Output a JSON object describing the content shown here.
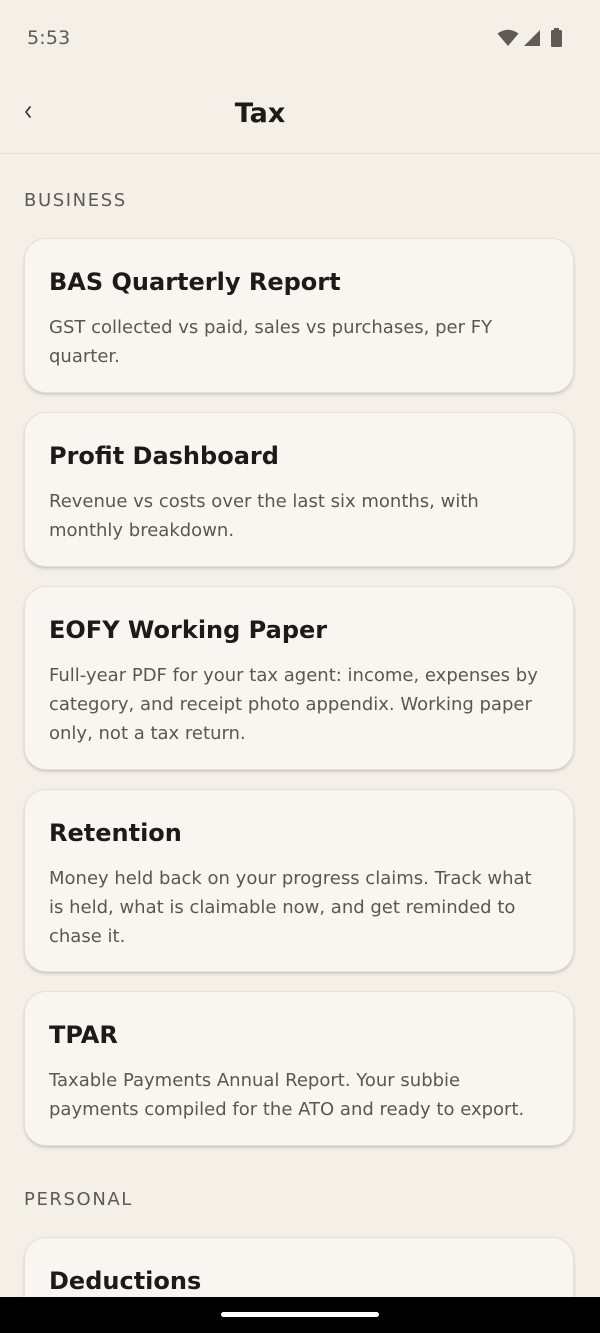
{
  "status_bar": {
    "time": "5:53",
    "icons": [
      "wifi-icon",
      "cellular-signal-icon",
      "battery-icon"
    ]
  },
  "app_bar": {
    "back_icon": "chevron-left-icon",
    "title": "Tax"
  },
  "sections": [
    {
      "label": "BUSINESS",
      "cards": [
        {
          "title": "BAS Quarterly Report",
          "description": "GST collected vs paid, sales vs purchases, per FY quarter."
        },
        {
          "title": "Profit Dashboard",
          "description": "Revenue vs costs over the last six months, with monthly breakdown."
        },
        {
          "title": "EOFY Working Paper",
          "description": "Full-year PDF for your tax agent: income, expenses by category, and receipt photo appendix. Working paper only, not a tax return."
        },
        {
          "title": "Retention",
          "description": "Money held back on your progress claims. Track what is held, what is claimable now, and get reminded to chase it."
        },
        {
          "title": "TPAR",
          "description": "Taxable Payments Annual Report. Your subbie payments compiled for the ATO and ready to export."
        }
      ]
    },
    {
      "label": "PERSONAL",
      "cards": [
        {
          "title": "Deductions"
        }
      ]
    }
  ],
  "colors": {
    "background": "#f4efe7",
    "card_background": "#f9f6f1",
    "title_text": "#1c1b1a",
    "secondary_text": "#5b5650"
  }
}
